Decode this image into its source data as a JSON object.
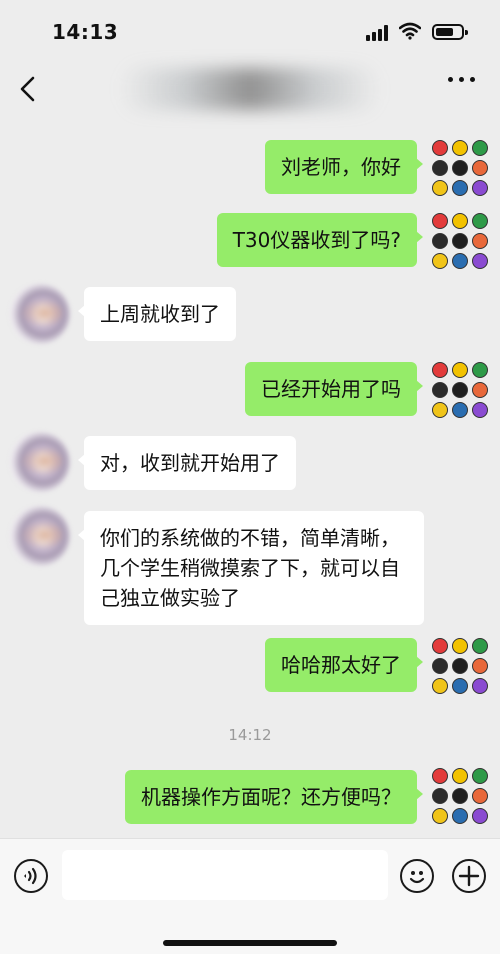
{
  "status_bar": {
    "time": "14:13"
  },
  "header": {
    "title": ""
  },
  "messages": [
    {
      "side": "out",
      "text": "刘老师，你好"
    },
    {
      "side": "out",
      "text": "T30仪器收到了吗?"
    },
    {
      "side": "in",
      "text": "上周就收到了"
    },
    {
      "side": "out",
      "text": "已经开始用了吗"
    },
    {
      "side": "in",
      "text": "对，收到就开始用了"
    },
    {
      "side": "in",
      "text": "你们的系统做的不错，简单清晰，几个学生稍微摸索了下，就可以自己独立做实验了"
    },
    {
      "side": "out",
      "text": "哈哈那太好了"
    },
    {
      "side": "out",
      "text": "机器操作方面呢？还方便吗？"
    }
  ],
  "timestamp": "14:12",
  "composer": {
    "value": ""
  },
  "icons": [
    "back-icon",
    "more-icon",
    "voice-icon",
    "emoji-icon",
    "plus-icon"
  ],
  "colors": {
    "outgoing_bubble": "#95ec69",
    "incoming_bubble": "#ffffff",
    "background": "#ededed",
    "avatar_me_dots": [
      "#e23b3b",
      "#f2c200",
      "#2e9a48",
      "#2b2b2b",
      "#1f1f1f",
      "#e8683a",
      "#f0c419",
      "#2a6db0",
      "#8a4bd1"
    ]
  }
}
